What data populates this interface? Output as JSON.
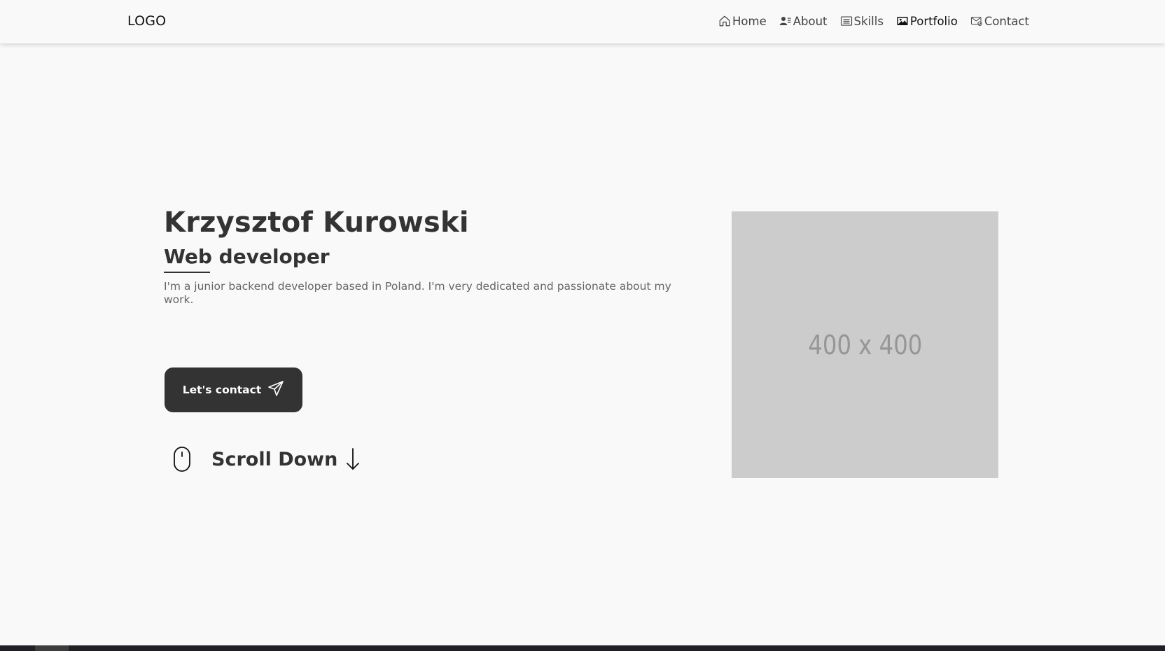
{
  "header": {
    "logo": "LOGO",
    "nav": [
      {
        "label": "Home",
        "icon": "home-icon"
      },
      {
        "label": "About",
        "icon": "user-card-icon"
      },
      {
        "label": "Skills",
        "icon": "list-icon"
      },
      {
        "label": "Portfolio",
        "icon": "image-icon",
        "active": true
      },
      {
        "label": "Contact",
        "icon": "mail-icon"
      }
    ]
  },
  "hero": {
    "name": "Krzysztof Kurowski",
    "role": "Web developer",
    "description": "I'm a junior backend developer based in Poland. I'm very dedicated and passionate about my work.",
    "contact_button": "Let's contact",
    "scroll_label": "Scroll Down",
    "placeholder_text": "400 x 400"
  },
  "colors": {
    "background": "#f9f9f9",
    "primary": "#333333",
    "placeholder": "#cccccc"
  }
}
